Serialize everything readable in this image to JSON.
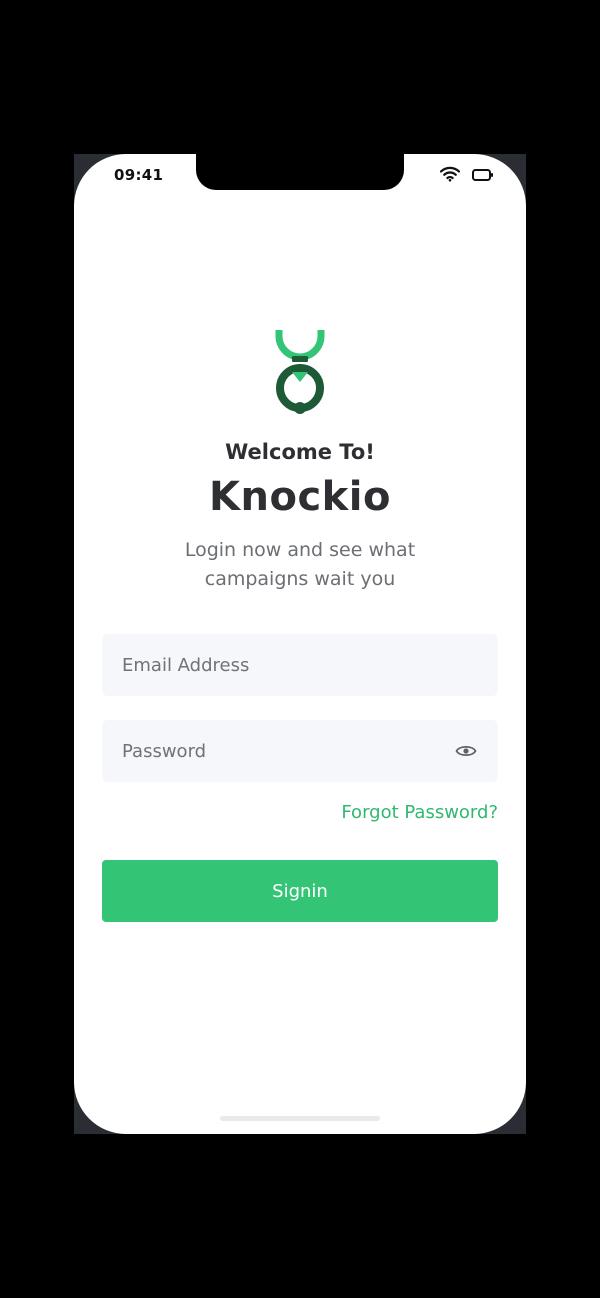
{
  "status_bar": {
    "time": "09:41",
    "wifi_icon": "wifi-icon",
    "battery_icon": "battery-icon"
  },
  "brand": {
    "logo_icon": "knockio-logo",
    "welcome": "Welcome To!",
    "app_name": "Knockio",
    "subtitle": "Login now and see what campaigns wait you",
    "colors": {
      "primary_green": "#33c476",
      "dark_green": "#1f5a36",
      "link_green": "#2fb872"
    }
  },
  "form": {
    "email": {
      "placeholder": "Email Address",
      "value": ""
    },
    "password": {
      "placeholder": "Password",
      "value": "",
      "toggle_icon": "eye-icon"
    },
    "forgot_label": "Forgot Password?",
    "submit_label": "Signin"
  }
}
